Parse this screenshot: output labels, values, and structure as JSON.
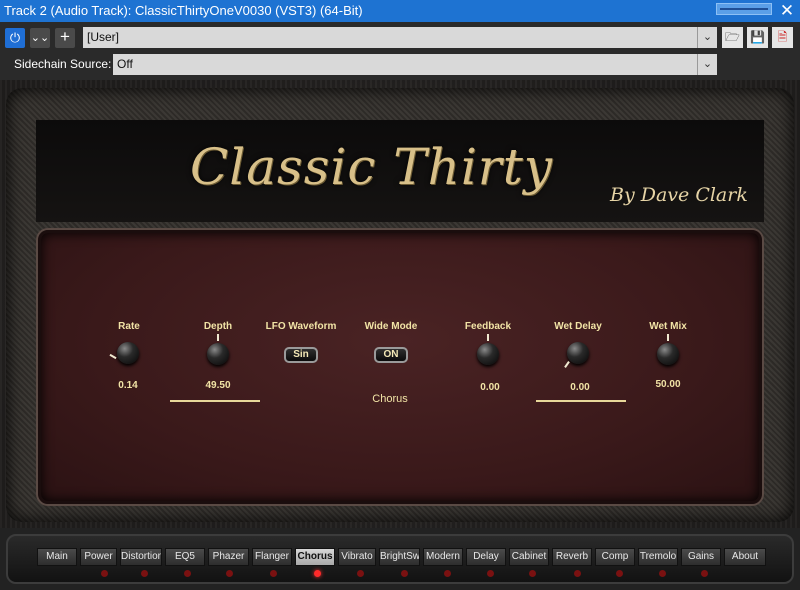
{
  "window": {
    "title": "Track 2 (Audio Track): ClassicThirtyOneV0030 (VST3) (64-Bit)",
    "close_glyph": "✕"
  },
  "toolbar": {
    "power_icon": "⏻",
    "collapse_icon": "⌄⌄",
    "add_icon": "+",
    "preset_value": "[User]",
    "open_icon": "🗁",
    "save_icon": "💾",
    "delete_icon": "🗎",
    "dropdown_glyph": "⌄",
    "sidechain_label": "Sidechain Source:",
    "sidechain_value": "Off"
  },
  "amp": {
    "logo_text": "Classic Thirty",
    "byline": "By Dave Clark",
    "section_label": "Chorus",
    "controls": [
      {
        "label": "Rate",
        "value": "0.14"
      },
      {
        "label": "Depth",
        "value": "49.50"
      },
      {
        "label": "LFO Waveform",
        "button": "Sin"
      },
      {
        "label": "Wide Mode",
        "button": "ON"
      },
      {
        "label": "Feedback",
        "value": "0.00"
      },
      {
        "label": "Wet Delay",
        "value": "0.00"
      },
      {
        "label": "Wet Mix",
        "value": "50.00"
      }
    ]
  },
  "nav": {
    "tabs": [
      "Main",
      "Power",
      "Distortion",
      "EQ5",
      "Phazer",
      "Flanger",
      "Chorus",
      "Vibrato",
      "BrightSw",
      "Modern",
      "Delay",
      "Cabinet",
      "Reverb",
      "Comp",
      "Tremolo",
      "Gains",
      "About"
    ],
    "active": "Chorus"
  },
  "colors": {
    "title_bar": "#1e73d2",
    "label_gold": "#f2e4a6",
    "panel_red": "#3a191a",
    "led_on": "#ff2a2a"
  }
}
